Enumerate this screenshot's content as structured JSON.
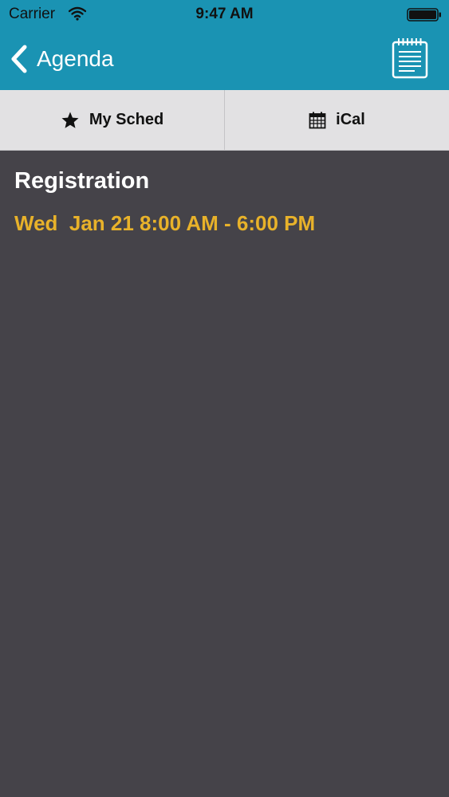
{
  "status_bar": {
    "carrier": "Carrier",
    "time": "9:47 AM",
    "icons": [
      "wifi-icon",
      "battery-icon"
    ]
  },
  "nav": {
    "back_label": "Agenda",
    "back_icon": "chevron-left-icon",
    "action_icon": "notepad-icon"
  },
  "tabs": [
    {
      "label": "My Sched",
      "icon": "star-icon"
    },
    {
      "label": "iCal",
      "icon": "calendar-icon"
    }
  ],
  "session": {
    "title": "Registration",
    "time": "Wed  Jan 21 8:00 AM - 6:00 PM"
  },
  "colors": {
    "header": "#1a93b3",
    "background": "#454349",
    "tabbar": "#e2e1e3",
    "time_accent": "#e8b22a"
  }
}
